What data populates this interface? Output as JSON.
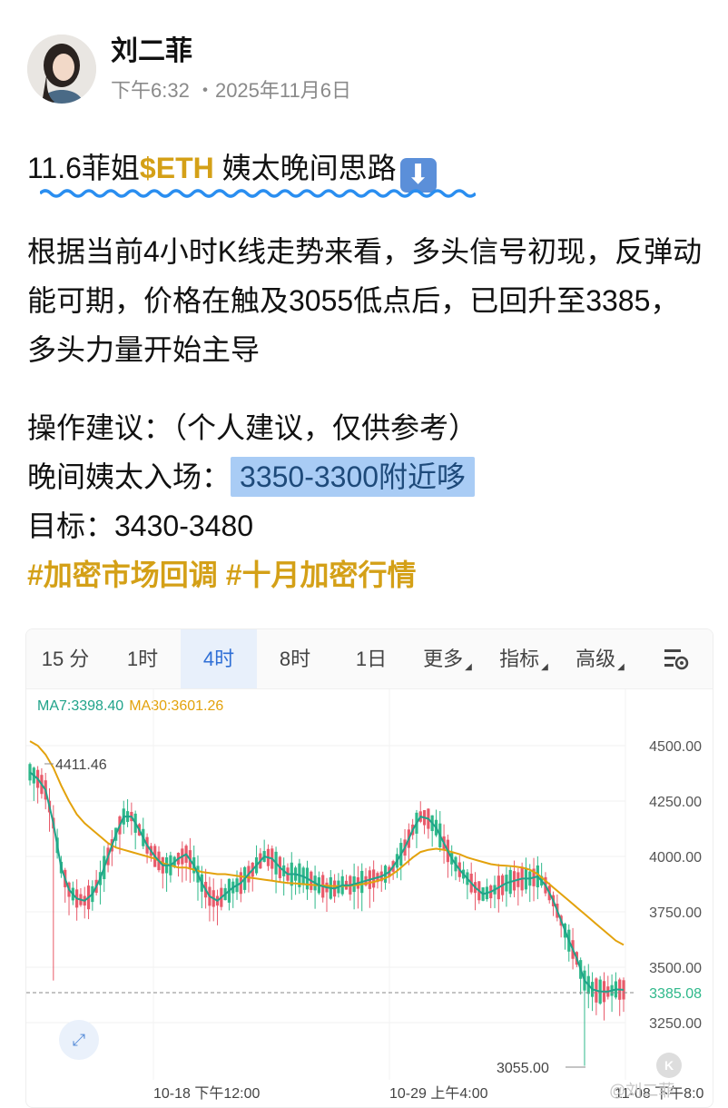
{
  "post": {
    "author": "刘二菲",
    "time": "下午6:32",
    "date": "2025年11月6日",
    "title_prefix": "11.6菲姐",
    "title_tag": "$ETH",
    "title_suffix": " 姨太晚间思路",
    "title_icon": "down-arrow-emoji",
    "body": "根据当前4小时K线走势来看，多头信号初现，反弹动能可期，价格在触及3055低点后，已回升至3385，多头力量开始主导",
    "ops_label": "操作建议：（个人建议，仅供参考）",
    "entry_label": "晚间姨太入场：",
    "entry_value": "3350-3300附近哆",
    "target_label": "目标：3430-3480",
    "hashtags": "#加密市场回调 #十月加密行情"
  },
  "chart": {
    "tabs": [
      {
        "label": "15 分",
        "active": false
      },
      {
        "label": "1时",
        "active": false
      },
      {
        "label": "4时",
        "active": true
      },
      {
        "label": "8时",
        "active": false
      },
      {
        "label": "1日",
        "active": false
      },
      {
        "label": "更多",
        "active": false,
        "dropdown": true
      },
      {
        "label": "指标",
        "active": false,
        "dropdown": true
      },
      {
        "label": "高级",
        "active": false,
        "dropdown": true
      }
    ],
    "ma7_label": "MA7:3398.40",
    "ma30_label": "MA30:3601.26",
    "colors": {
      "up": "#2eb88a",
      "down": "#e85a6a",
      "ma7": "#20a38a",
      "ma30": "#e3a20c",
      "accent": "#2f6fd6",
      "hashtag": "#d4a017"
    },
    "watermark": "@刘二菲"
  },
  "chart_data": {
    "type": "line",
    "title": "",
    "xlabel": "",
    "ylabel": "",
    "y_ticks": [
      "4500.00",
      "4250.00",
      "4000.00",
      "3750.00",
      "3500.00",
      "3250.00"
    ],
    "x_ticks": [
      "10-18 下午12:00",
      "10-29 上午4:00",
      "11-08 下午8:0"
    ],
    "ylim": [
      3050,
      4590
    ],
    "last_price": "3385.08",
    "high_label": "4411.46",
    "low_label": "3055.00",
    "series": [
      {
        "name": "MA7",
        "values": [
          4380,
          4350,
          4300,
          4150,
          3950,
          3850,
          3810,
          3800,
          3830,
          3900,
          4000,
          4100,
          4180,
          4180,
          4120,
          4050,
          4000,
          3960,
          3960,
          3990,
          4010,
          3960,
          3880,
          3820,
          3800,
          3830,
          3860,
          3880,
          3920,
          3960,
          4000,
          3990,
          3950,
          3920,
          3920,
          3910,
          3890,
          3870,
          3860,
          3855,
          3870,
          3870,
          3880,
          3890,
          3900,
          3910,
          3930,
          3980,
          4040,
          4120,
          4180,
          4170,
          4130,
          4060,
          3990,
          3940,
          3900,
          3860,
          3830,
          3840,
          3860,
          3880,
          3890,
          3900,
          3900,
          3910,
          3870,
          3800,
          3710,
          3620,
          3540,
          3440,
          3400,
          3390,
          3390,
          3400,
          3398
        ]
      },
      {
        "name": "MA30",
        "values": [
          4520,
          4500,
          4460,
          4400,
          4320,
          4250,
          4190,
          4150,
          4120,
          4090,
          4060,
          4040,
          4030,
          4020,
          4010,
          4000,
          3990,
          3970,
          3960,
          3950,
          3950,
          3940,
          3930,
          3925,
          3920,
          3920,
          3915,
          3910,
          3905,
          3900,
          3895,
          3890,
          3885,
          3880,
          3878,
          3875,
          3872,
          3870,
          3868,
          3866,
          3866,
          3868,
          3872,
          3878,
          3885,
          3895,
          3910,
          3935,
          3965,
          3995,
          4020,
          4030,
          4035,
          4030,
          4020,
          4010,
          3995,
          3985,
          3975,
          3965,
          3960,
          3958,
          3955,
          3950,
          3940,
          3920,
          3890,
          3860,
          3830,
          3800,
          3770,
          3740,
          3710,
          3680,
          3650,
          3620,
          3601
        ]
      }
    ],
    "grid": true,
    "legend": "top-left"
  }
}
